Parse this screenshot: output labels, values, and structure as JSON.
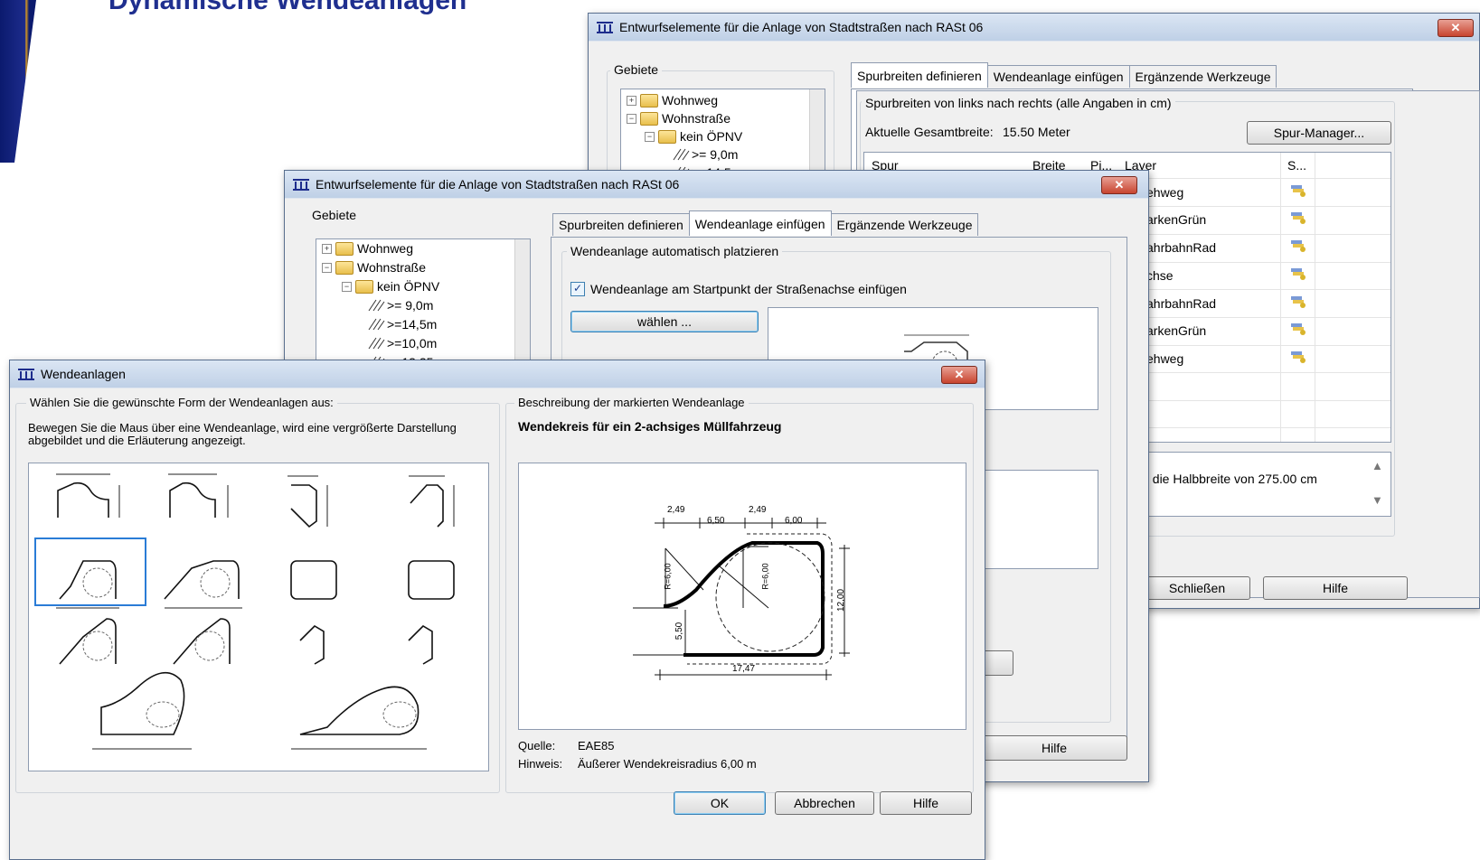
{
  "slide": {
    "title": "Dynamische Wendeanlagen"
  },
  "back_window": {
    "title": "Entwurfselemente für die Anlage von Stadtstraßen nach RASt 06",
    "close": "✕",
    "gebiete_label": "Gebiete",
    "tree": [
      {
        "label": "Wohnweg",
        "toggle": "+"
      },
      {
        "label": "Wohnstraße",
        "toggle": "−"
      },
      {
        "label": "kein ÖPNV",
        "toggle": "−"
      },
      {
        "label": ">= 9,0m"
      },
      {
        "label": ">=14,5m"
      }
    ],
    "tabs": [
      "Spurbreiten definieren",
      "Wendeanlage einfügen",
      "Ergänzende Werkzeuge"
    ],
    "spurbreiten_label": "Spurbreiten von links nach rechts (alle Angaben in cm)",
    "gesamtbreite_label": "Aktuelle Gesamtbreite:",
    "gesamtbreite_value": "15.50 Meter",
    "spur_manager": "Spur-Manager...",
    "columns": [
      "Spur",
      "Breite",
      "Pi...",
      "Layer",
      "S..."
    ],
    "layers": [
      "ehweg",
      "arkenGrün",
      "ahrbahnRad",
      "chse",
      "ahrbahnRad",
      "arkenGrün",
      "ehweg"
    ],
    "note": ", die Halbbreite von 275.00 cm",
    "btn_close": "Schließen",
    "btn_help": "Hilfe"
  },
  "mid_window": {
    "title": "Entwurfselemente für die Anlage von Stadtstraßen nach RASt 06",
    "close": "✕",
    "gebiete_label": "Gebiete",
    "tree": [
      {
        "label": "Wohnweg",
        "toggle": "+"
      },
      {
        "label": "Wohnstraße",
        "toggle": "−"
      },
      {
        "label": "kein ÖPNV",
        "toggle": "−"
      },
      {
        "label": ">= 9,0m"
      },
      {
        "label": ">=14,5m"
      },
      {
        "label": ">=10,0m"
      },
      {
        "label": ">=13,25m"
      }
    ],
    "tabs": [
      "Spurbreiten definieren",
      "Wendeanlage einfügen",
      "Ergänzende Werkzeuge"
    ],
    "auto_label": "Wendeanlage automatisch platzieren",
    "checkbox_label": "Wendeanlage am Startpunkt der Straßenachse einfügen",
    "checkbox_mark": "✓",
    "waehlen": "wählen ...",
    "btn_help": "Hilfe"
  },
  "front_window": {
    "title": "Wendeanlagen",
    "close": "✕",
    "left_group": "Wählen Sie die gewünschte Form der Wendeanlagen aus:",
    "left_info_line1": "Bewegen Sie die Maus über eine Wendeanlage, wird eine vergrößerte Darstellung",
    "left_info_line2": "abgebildet und die Erläuterung angezeigt.",
    "right_group": "Beschreibung der markierten Wendeanlage",
    "desc_title": "Wendekreis für ein 2-achsiges Müllfahrzeug",
    "diagram_labels": {
      "d1": "2,49",
      "d2": "6,50",
      "d3": "2,49",
      "d4": "6,00",
      "r1": "R=6,00",
      "r2": "R=6,00",
      "h1": "12,00",
      "h2": "5,50",
      "w": "17,47"
    },
    "quelle_label": "Quelle:",
    "quelle_value": "EAE85",
    "hinweis_label": "Hinweis:",
    "hinweis_value": "Äußerer Wendekreisradius 6,00 m",
    "btn_ok": "OK",
    "btn_cancel": "Abbrechen",
    "btn_help": "Hilfe"
  },
  "colors": {
    "title_blue": "#1f2f8f",
    "select_blue": "#2a7cd6",
    "close_red": "#c8442f"
  }
}
